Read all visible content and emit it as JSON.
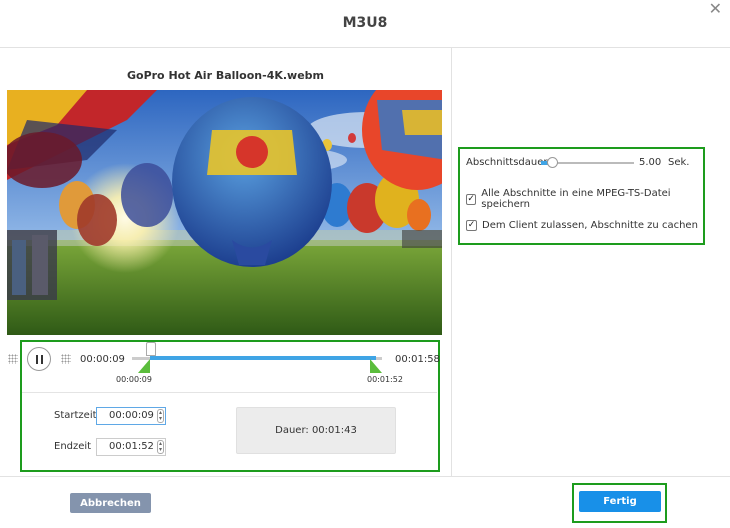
{
  "dialog": {
    "title": "M3U8",
    "close_glyph": "✕"
  },
  "video": {
    "filename": "GoPro Hot Air Balloon-4K.webm"
  },
  "player": {
    "current_time": "00:00:09",
    "total_time": "00:01:58",
    "trim_start_marker": "00:00:09",
    "trim_end_marker": "00:01:52",
    "playhead_fraction": 0.077,
    "trim_start_fraction": 0.077,
    "trim_end_fraction": 0.949
  },
  "trim": {
    "start_label": "Startzeit",
    "start_value": "00:00:09",
    "end_label": "Endzeit",
    "end_value": "00:01:52",
    "duration_text": "Dauer: 00:01:43"
  },
  "settings": {
    "segment_duration_label": "Abschnittsdauer:",
    "segment_duration_value": "5.00",
    "segment_duration_unit": "Sek.",
    "single_file_label": "Alle Abschnitte in eine MPEG-TS-Datei speichern",
    "single_file_checked": true,
    "client_cache_label": "Dem Client zulassen, Abschnitte zu cachen",
    "client_cache_checked": true,
    "check_glyph": "✓"
  },
  "footer": {
    "cancel_label": "Abbrechen",
    "done_label": "Fertig"
  },
  "colors": {
    "highlight": "#1d9c1d",
    "accent": "#1890e8",
    "trim_marker": "#5bbd3c",
    "cancel": "#8494ad"
  }
}
